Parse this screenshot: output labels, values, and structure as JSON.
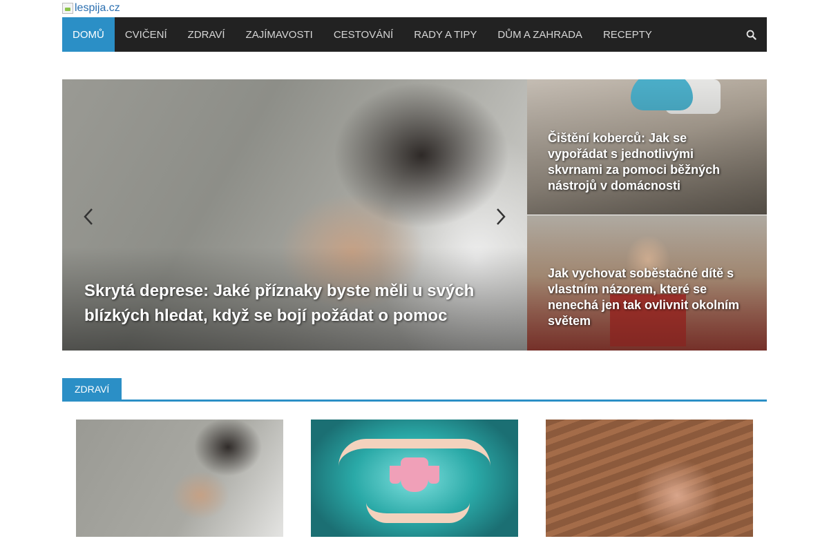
{
  "logo": {
    "alt": "lespija.cz"
  },
  "nav": {
    "items": [
      {
        "label": "DOMŮ",
        "active": true
      },
      {
        "label": "CVIČENÍ"
      },
      {
        "label": "ZDRAVÍ"
      },
      {
        "label": "ZAJÍMAVOSTI"
      },
      {
        "label": "CESTOVÁNÍ"
      },
      {
        "label": "RADY A TIPY"
      },
      {
        "label": "DŮM A ZAHRADA"
      },
      {
        "label": "RECEPTY"
      }
    ],
    "search_icon": "search-icon"
  },
  "hero": {
    "title": "Skrytá deprese: Jaké příznaky byste měli u svých blízkých hledat, když se bojí požádat o pomoc",
    "prev_icon": "chevron-left-icon",
    "next_icon": "chevron-right-icon"
  },
  "side_posts": [
    {
      "title": "Čištění koberců: Jak se vypořádat s jednotlivými skvrnami za pomoci běžných nástrojů v domácnosti"
    },
    {
      "title": "Jak vychovat soběstačné dítě s vlastním názorem, které se nenechá jen tak ovlivnit okolním světem"
    }
  ],
  "section": {
    "tab_label": "ZDRAVÍ"
  },
  "colors": {
    "accent": "#2b8fc6",
    "nav_bg": "#222222",
    "nav_text": "#d6d6d6"
  }
}
